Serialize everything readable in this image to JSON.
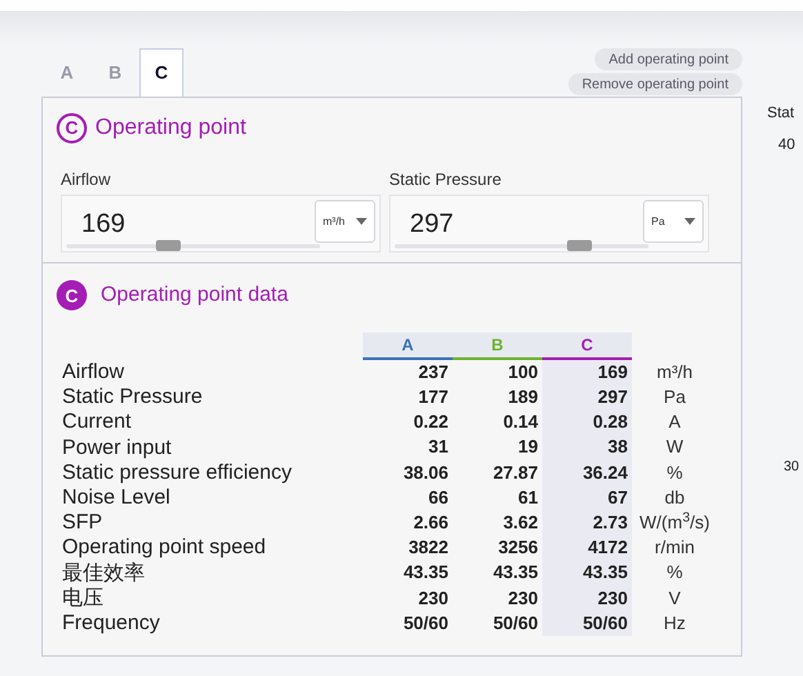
{
  "tabs": [
    {
      "label": "A",
      "selected": false
    },
    {
      "label": "B",
      "selected": false
    },
    {
      "label": "C",
      "selected": true
    }
  ],
  "actions": [
    "Add operating point",
    "Remove operating point"
  ],
  "operating_point": {
    "badge": "C",
    "title": "Operating point",
    "fields": [
      {
        "label": "Airflow",
        "value": "169",
        "unit": "m³/h",
        "level": 0.4
      },
      {
        "label": "Static Pressure",
        "value": "297",
        "unit": "Pa",
        "level": 0.73
      }
    ]
  },
  "data_panel": {
    "badge": "C",
    "title": "Operating point data",
    "columns": [
      {
        "label": "A",
        "color": "#3a72b8",
        "selected": false
      },
      {
        "label": "B",
        "color": "#6cb32f",
        "selected": false
      },
      {
        "label": "C",
        "color": "#a41db4",
        "selected": true
      }
    ],
    "rows": [
      {
        "name": "Airflow",
        "values": [
          "237",
          "100",
          "169"
        ],
        "unit": "m³/h"
      },
      {
        "name": "Static Pressure",
        "values": [
          "177",
          "189",
          "297"
        ],
        "unit": "Pa"
      },
      {
        "name": "Current",
        "values": [
          "0.22",
          "0.14",
          "0.28"
        ],
        "unit": "A"
      },
      {
        "name": "Power input",
        "values": [
          "31",
          "19",
          "38"
        ],
        "unit": "W"
      },
      {
        "name": "Static pressure efficiency",
        "values": [
          "38.06",
          "27.87",
          "36.24"
        ],
        "unit": "%"
      },
      {
        "name": "Noise Level",
        "values": [
          "66",
          "61",
          "67"
        ],
        "unit": "db"
      },
      {
        "name": "SFP",
        "values": [
          "2.66",
          "3.62",
          "2.73"
        ],
        "unit": "W/(m$^{3}$/s)"
      },
      {
        "name": "Operating point speed",
        "values": [
          "3822",
          "3256",
          "4172"
        ],
        "unit": "r/min"
      },
      {
        "name": "最佳效率",
        "values": [
          "43.35",
          "43.35",
          "43.35"
        ],
        "unit": "%"
      },
      {
        "name": "电压",
        "values": [
          "230",
          "230",
          "230"
        ],
        "unit": "V"
      },
      {
        "name": "Frequency",
        "values": [
          "50/60",
          "50/60",
          "50/60"
        ],
        "unit": "Hz"
      }
    ]
  },
  "side_texts": [
    "Stat",
    "40",
    "30"
  ]
}
